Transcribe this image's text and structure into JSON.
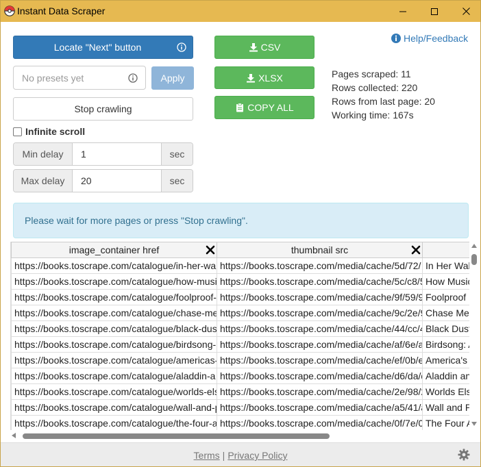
{
  "window": {
    "title": "Instant Data Scraper"
  },
  "controls": {
    "locate_next_label": "Locate \"Next\" button",
    "preset_placeholder": "No presets yet",
    "apply_label": "Apply",
    "stop_crawling_label": "Stop crawling",
    "infinite_scroll_label": "Infinite scroll",
    "min_delay_label": "Min delay",
    "min_delay_value": "1",
    "max_delay_label": "Max delay",
    "max_delay_value": "20",
    "delay_unit": "sec"
  },
  "export": {
    "csv_label": "CSV",
    "xlsx_label": "XLSX",
    "copy_all_label": "COPY ALL"
  },
  "help": {
    "label": "Help/Feedback"
  },
  "stats": {
    "pages_scraped": "Pages scraped: 11",
    "rows_collected": "Rows collected: 220",
    "rows_from_last_page": "Rows from last page: 20",
    "working_time": "Working time: 167s"
  },
  "alert": {
    "message": "Please wait for more pages or press \"Stop crawling\"."
  },
  "table": {
    "columns": [
      "image_container href",
      "thumbnail src",
      ""
    ],
    "rows": [
      [
        "https://books.toscrape.com/catalogue/in-her-wa",
        "https://books.toscrape.com/media/cache/5d/72/",
        "In Her Wal"
      ],
      [
        "https://books.toscrape.com/catalogue/how-musi",
        "https://books.toscrape.com/media/cache/5c/c8/5",
        "How Music"
      ],
      [
        "https://books.toscrape.com/catalogue/foolproof-",
        "https://books.toscrape.com/media/cache/9f/59/9",
        "Foolproof P"
      ],
      [
        "https://books.toscrape.com/catalogue/chase-me",
        "https://books.toscrape.com/media/cache/9c/2e/9",
        "Chase Me"
      ],
      [
        "https://books.toscrape.com/catalogue/black-dus",
        "https://books.toscrape.com/media/cache/44/cc/4",
        "Black Dust"
      ],
      [
        "https://books.toscrape.com/catalogue/birdsong-",
        "https://books.toscrape.com/media/cache/af/6e/a",
        "Birdsong: A"
      ],
      [
        "https://books.toscrape.com/catalogue/americas-",
        "https://books.toscrape.com/media/cache/ef/0b/e",
        "America's"
      ],
      [
        "https://books.toscrape.com/catalogue/aladdin-a",
        "https://books.toscrape.com/media/cache/d6/da/d",
        "Aladdin an"
      ],
      [
        "https://books.toscrape.com/catalogue/worlds-els",
        "https://books.toscrape.com/media/cache/2e/98/2",
        "Worlds Els"
      ],
      [
        "https://books.toscrape.com/catalogue/wall-and-p",
        "https://books.toscrape.com/media/cache/a5/41/a",
        "Wall and P"
      ],
      [
        "https://books.toscrape.com/catalogue/the-four-a",
        "https://books.toscrape.com/media/cache/0f/7e/0",
        "The Four A"
      ]
    ]
  },
  "footer": {
    "terms_label": "Terms",
    "separator": "|",
    "privacy_label": "Privacy Policy"
  },
  "colors": {
    "titlebar": "#e6b951",
    "primary": "#337ab7",
    "success": "#5cb85c",
    "info_bg": "#d9edf7"
  }
}
